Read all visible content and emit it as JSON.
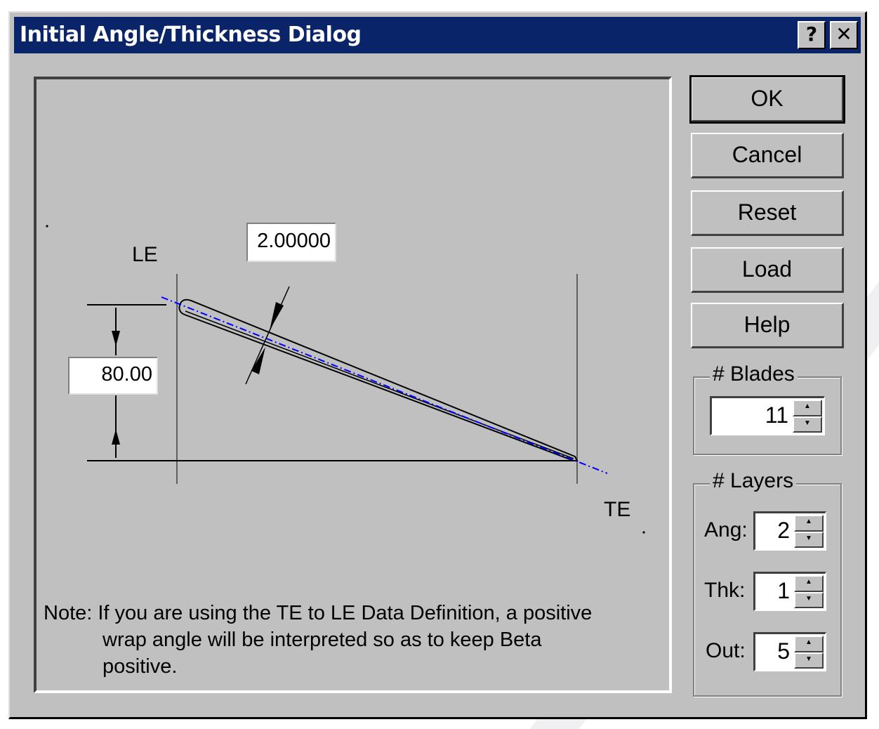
{
  "window": {
    "title": "Initial Angle/Thickness Dialog",
    "help_glyph": "?",
    "close_glyph": "✕"
  },
  "figure": {
    "le_label": "LE",
    "te_label": "TE",
    "angle_value": "80.00",
    "thickness_value": "2.00000"
  },
  "note": {
    "line1": "Note: If you are using the TE to LE Data Definition, a positive",
    "line2": "wrap angle will be interpreted so as to keep Beta",
    "line3": "positive."
  },
  "buttons": {
    "ok": "OK",
    "cancel": "Cancel",
    "reset": "Reset",
    "load": "Load",
    "help": "Help"
  },
  "blades": {
    "label": "# Blades",
    "value": "11"
  },
  "layers": {
    "label": "# Layers",
    "ang_label": "Ang:",
    "ang_value": "2",
    "thk_label": "Thk:",
    "thk_value": "1",
    "out_label": "Out:",
    "out_value": "5"
  },
  "colors": {
    "titlebar": "#0a246a",
    "face": "#c0c0c0",
    "camber_line": "#0000ff"
  }
}
